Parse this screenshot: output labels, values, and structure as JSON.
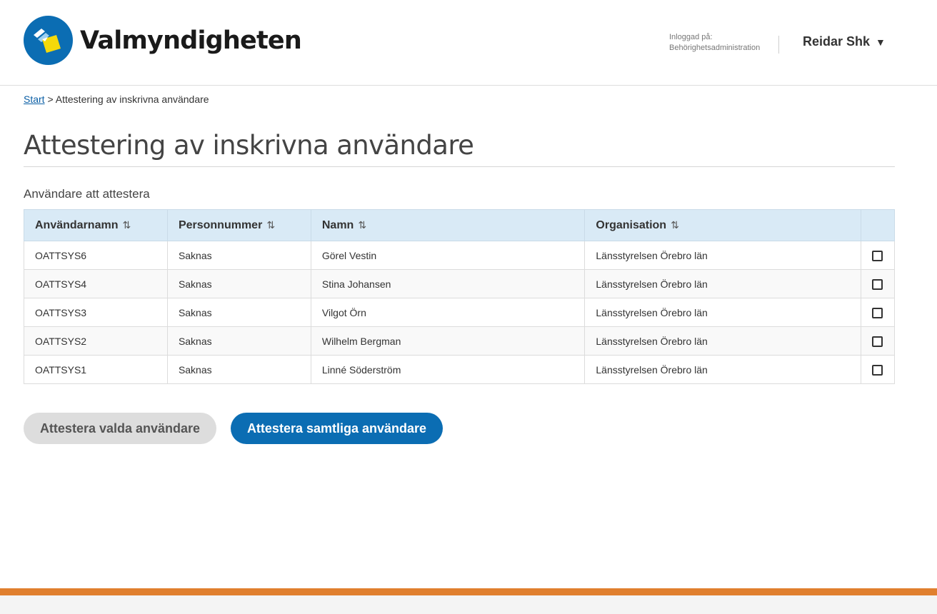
{
  "header": {
    "brand": "Valmyndigheten",
    "login_label": "Inloggad på:",
    "login_context": "Behörighetsadministration",
    "user_name": "Reidar Shk",
    "user_caret": "▼"
  },
  "breadcrumb": {
    "start": "Start",
    "separator": ">",
    "current": "Attestering av inskrivna användare"
  },
  "page_title": "Attestering av inskrivna användare",
  "section_label": "Användare att attestera",
  "table": {
    "columns": [
      "Användarnamn",
      "Personnummer",
      "Namn",
      "Organisation"
    ],
    "sort_icon": "⇅",
    "rows": [
      {
        "username": "OATTSYS6",
        "personnummer": "Saknas",
        "name": "Görel Vestin",
        "organisation": "Länsstyrelsen Örebro län",
        "checked": false
      },
      {
        "username": "OATTSYS4",
        "personnummer": "Saknas",
        "name": "Stina Johansen",
        "organisation": "Länsstyrelsen Örebro län",
        "checked": false
      },
      {
        "username": "OATTSYS3",
        "personnummer": "Saknas",
        "name": "Vilgot Örn",
        "organisation": "Länsstyrelsen Örebro län",
        "checked": false
      },
      {
        "username": "OATTSYS2",
        "personnummer": "Saknas",
        "name": "Wilhelm Bergman",
        "organisation": "Länsstyrelsen Örebro län",
        "checked": false
      },
      {
        "username": "OATTSYS1",
        "personnummer": "Saknas",
        "name": "Linné Söderström",
        "organisation": "Länsstyrelsen Örebro län",
        "checked": false
      }
    ]
  },
  "buttons": {
    "attest_selected": "Attestera valda användare",
    "attest_all": "Attestera samtliga användare"
  },
  "colors": {
    "primary": "#0b6db3",
    "header_row": "#d9eaf6",
    "footer_accent": "#e07f2e",
    "logo_circle": "#0b6db3",
    "logo_yellow": "#f5d90a"
  }
}
